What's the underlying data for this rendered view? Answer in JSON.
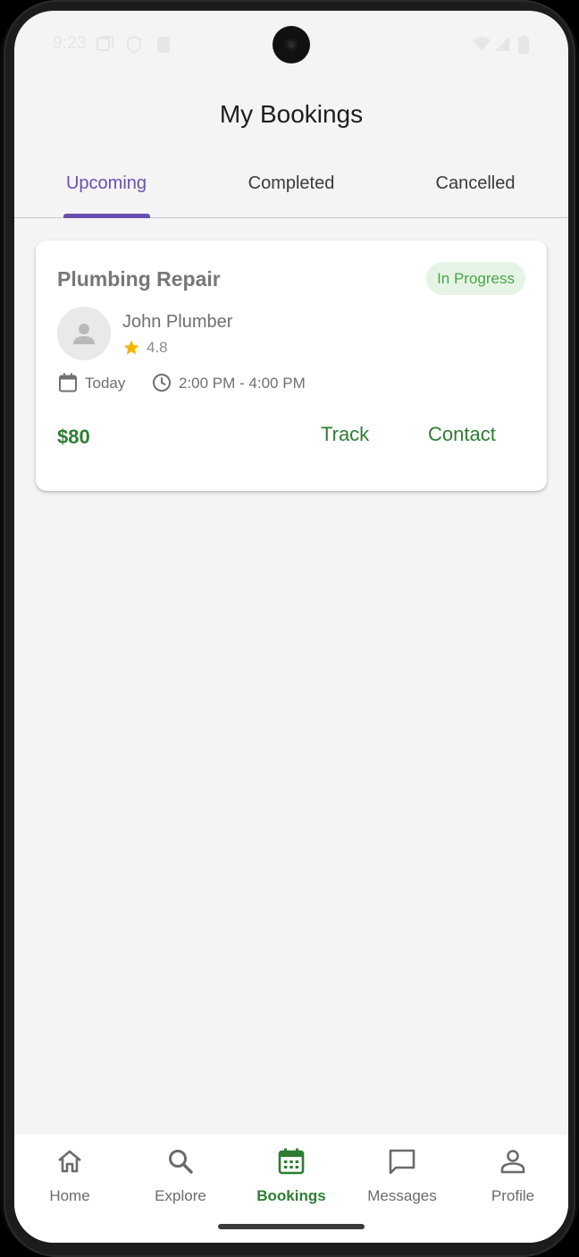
{
  "status_bar": {
    "time": "9:23"
  },
  "header": {
    "title": "My Bookings"
  },
  "tabs": [
    {
      "label": "Upcoming",
      "active": true
    },
    {
      "label": "Completed",
      "active": false
    },
    {
      "label": "Cancelled",
      "active": false
    }
  ],
  "booking": {
    "service": "Plumbing Repair",
    "status": "In Progress",
    "provider": "John Plumber",
    "rating": "4.8",
    "date": "Today",
    "time": "2:00 PM - 4:00 PM",
    "price": "$80",
    "track_label": "Track",
    "contact_label": "Contact"
  },
  "bottom_nav": [
    {
      "label": "Home",
      "icon": "home-icon",
      "active": false
    },
    {
      "label": "Explore",
      "icon": "search-icon",
      "active": false
    },
    {
      "label": "Bookings",
      "icon": "calendar-icon",
      "active": true
    },
    {
      "label": "Messages",
      "icon": "message-icon",
      "active": false
    },
    {
      "label": "Profile",
      "icon": "person-icon",
      "active": false
    }
  ],
  "colors": {
    "accent_purple": "#6a4fb0",
    "accent_green": "#2e7d32",
    "status_green": "#48a64c",
    "status_bg": "#e6f4e6",
    "star": "#f2b600",
    "background": "#f4f4f4"
  }
}
